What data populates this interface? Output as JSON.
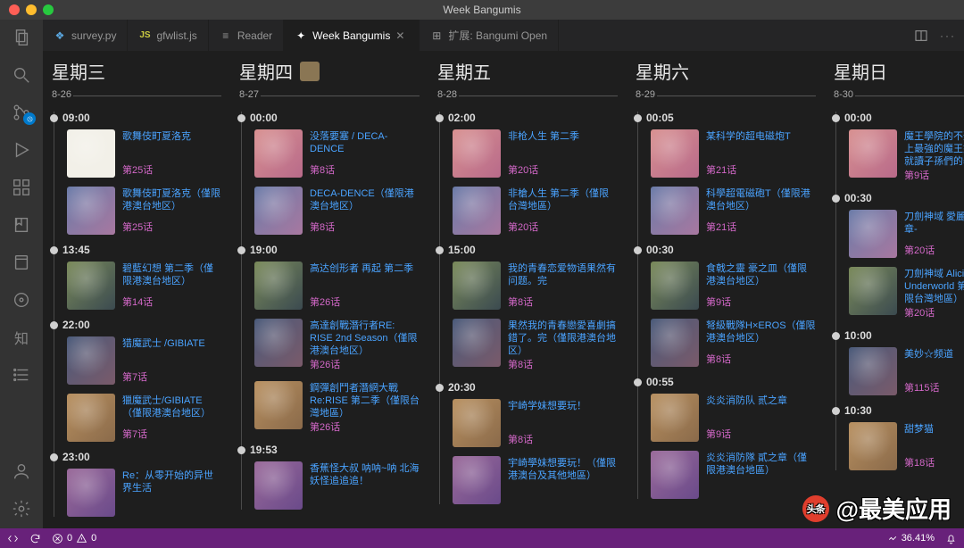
{
  "window_title": "Week Bangumis",
  "tabs": [
    {
      "icon": "py",
      "label": "survey.py",
      "color": "#5aa7e0"
    },
    {
      "icon": "js",
      "label": "gfwlist.js",
      "color": "#cbcb41"
    },
    {
      "icon": "book",
      "label": "Reader",
      "color": "#999"
    },
    {
      "icon": "sparkle",
      "label": "Week Bangumis",
      "color": "#bbb",
      "active": true,
      "closable": true
    },
    {
      "icon": "ext",
      "label": "扩展: Bangumi Open",
      "color": "#999"
    }
  ],
  "status": {
    "sync": "⟲",
    "errors": "0",
    "warnings": "0",
    "pct": "36.41%",
    "bell": "🔔"
  },
  "watermark": "@最美应用",
  "days": [
    {
      "name": "星期三",
      "date": "8-26",
      "first": true,
      "slots": [
        {
          "time": "09:00",
          "items": [
            {
              "title": "歌舞伎町夏洛克",
              "ep": "第25话",
              "thumb": "wh"
            },
            {
              "title": "歌舞伎町夏洛克（僅限港澳台地区）",
              "ep": "第25话"
            }
          ]
        },
        {
          "time": "13:45",
          "items": [
            {
              "title": "碧藍幻想 第二季（僅限港澳台地区）",
              "ep": "第14话"
            }
          ]
        },
        {
          "time": "22:00",
          "items": [
            {
              "title": "猎魔武士 /GIBIATE",
              "ep": "第7话"
            },
            {
              "title": "獵魔武士/GIBIATE（僅限港澳台地区）",
              "ep": "第7话"
            }
          ]
        },
        {
          "time": "23:00",
          "items": [
            {
              "title": "Re：从零开始的异世界生活",
              "ep": ""
            }
          ]
        }
      ]
    },
    {
      "name": "星期四",
      "date": "8-27",
      "icon": true,
      "slots": [
        {
          "time": "00:00",
          "items": [
            {
              "title": "没落要塞 / DECA-DENCE",
              "ep": "第8话"
            },
            {
              "title": "DECA-DENCE（僅限港澳台地区）",
              "ep": "第8话"
            }
          ]
        },
        {
          "time": "19:00",
          "items": [
            {
              "title": "高达创形者 再起 第二季",
              "ep": "第26话"
            },
            {
              "title": "高達創戰潛行者RE: RISE 2nd Season（僅限港澳台地区）",
              "ep": "第26话"
            },
            {
              "title": "鋼彈創鬥者潛網大戰 Re:RISE 第二季（僅限台灣地區）",
              "ep": "第26话"
            }
          ]
        },
        {
          "time": "19:53",
          "items": [
            {
              "title": "香蕉怪大叔 呐呐~呐 北海妖怪追追追！",
              "ep": ""
            }
          ]
        }
      ]
    },
    {
      "name": "星期五",
      "date": "8-28",
      "slots": [
        {
          "time": "02:00",
          "items": [
            {
              "title": "非枪人生 第二季",
              "ep": "第20话"
            },
            {
              "title": "非槍人生 第二季（僅限台灣地區）",
              "ep": "第20话"
            }
          ]
        },
        {
          "time": "15:00",
          "items": [
            {
              "title": "我的青春恋爱物语果然有问题。完",
              "ep": "第8话"
            },
            {
              "title": "果然我的青春戀愛喜劇搞錯了。完（僅限港澳台地区）",
              "ep": "第8话"
            }
          ]
        },
        {
          "time": "20:30",
          "items": [
            {
              "title": "宇崎学妹想要玩！",
              "ep": "第8话"
            },
            {
              "title": "宇崎學妹想要玩！（僅限港澳台及其他地區）",
              "ep": ""
            }
          ]
        }
      ]
    },
    {
      "name": "星期六",
      "date": "8-29",
      "slots": [
        {
          "time": "00:05",
          "items": [
            {
              "title": "某科学的超电磁炮T",
              "ep": "第21话"
            },
            {
              "title": "科學超電磁砲T（僅限港澳台地区）",
              "ep": "第21话"
            }
          ]
        },
        {
          "time": "00:30",
          "items": [
            {
              "title": "食戟之靈 豪之皿（僅限港澳台地区）",
              "ep": "第9话"
            },
            {
              "title": "弩級戰隊H×EROS（僅限港澳台地区）",
              "ep": "第8话"
            }
          ]
        },
        {
          "time": "00:55",
          "items": [
            {
              "title": "炎炎消防队 贰之章",
              "ep": "第9话"
            },
            {
              "title": "炎炎消防隊 貳之章（僅限港澳台地區）",
              "ep": ""
            }
          ]
        }
      ]
    },
    {
      "name": "星期日",
      "date": "8-30",
      "slots": [
        {
          "time": "00:00",
          "items": [
            {
              "title": "魔王學院的不適任者～史上最強的魔王始祖、轉生就讀子孫們的學校～",
              "ep": "第9话"
            }
          ]
        },
        {
          "time": "00:30",
          "items": [
            {
              "title": "刀劍神域 愛麗絲篇 -終章-",
              "ep": "第20话"
            },
            {
              "title": "刀劍神域 Alicization Underworld 第二季（僅限台灣地區）",
              "ep": "第20话"
            }
          ]
        },
        {
          "time": "10:00",
          "items": [
            {
              "title": "美妙☆频道",
              "ep": "第115话"
            }
          ]
        },
        {
          "time": "10:30",
          "items": [
            {
              "title": "甜梦猫",
              "ep": "第18话"
            }
          ]
        }
      ]
    }
  ]
}
